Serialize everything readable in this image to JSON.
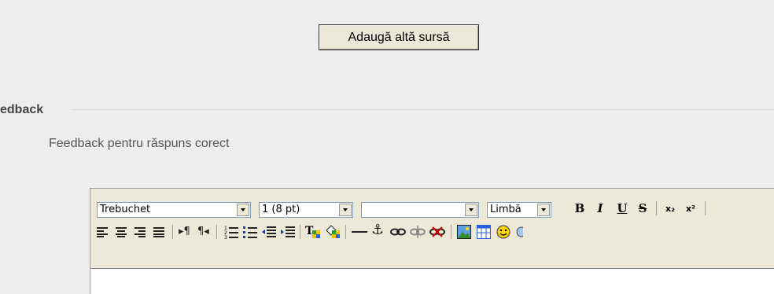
{
  "add_source_button": "Adaugă altă sursă",
  "section_legend": "edback",
  "feedback_label": "Feedback pentru răspuns corect",
  "toolbar": {
    "font_family": "Trebuchet",
    "font_size": "1 (8 pt)",
    "format": "",
    "language": "Limbă",
    "bold": "B",
    "italic": "I",
    "underline": "U",
    "strike": "S",
    "subscript": "x₂",
    "superscript": "x²"
  },
  "colors": {
    "background": "#eeeeee",
    "toolbar": "#ece9d8"
  }
}
